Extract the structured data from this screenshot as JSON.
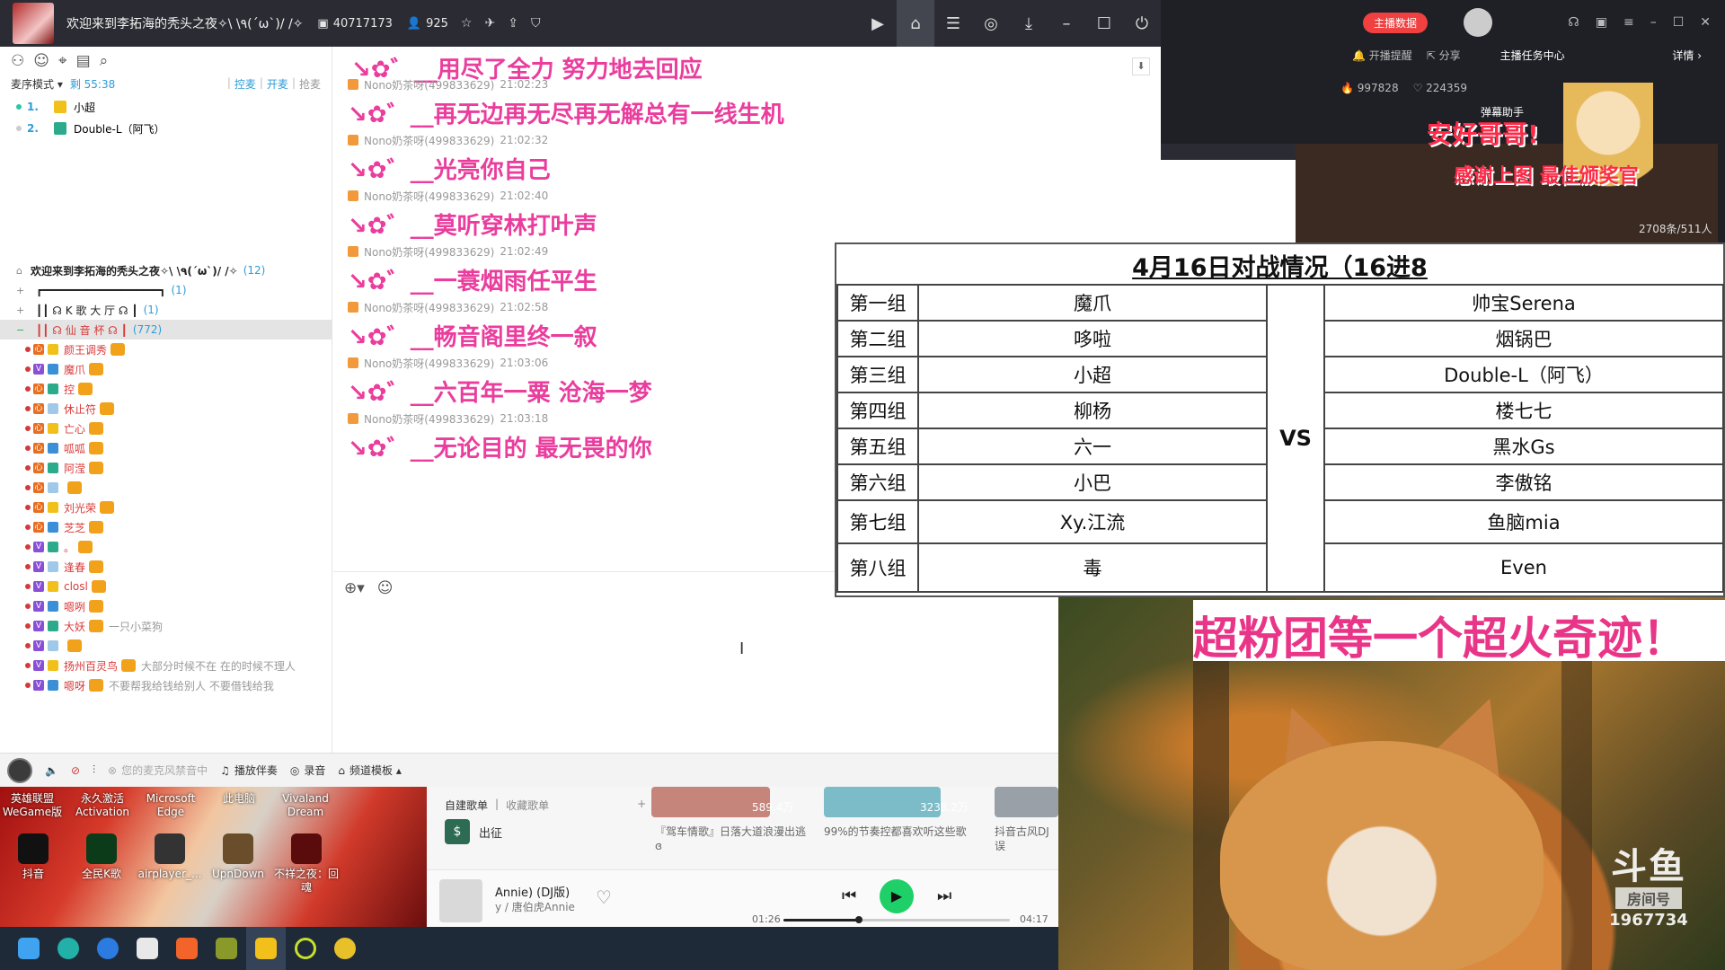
{
  "yy": {
    "title": "欢迎来到李拓海的秃头之夜✧\\ \\٩(ˊωˋ)/ /✧",
    "room_id": "40717173",
    "online": "925",
    "panel": {
      "mic_mode": "麦序模式 ▾",
      "remaining": "剩 55:38",
      "actions": [
        "控麦",
        "开麦",
        "抢麦"
      ],
      "queue": [
        {
          "num": "1.",
          "name": "小超"
        },
        {
          "num": "2.",
          "name": "Double-L（阿飞）"
        }
      ]
    },
    "tree": {
      "root": {
        "name": "欢迎来到李拓海的秃头之夜✧\\ \\٩(ˊωˋ)/ /✧",
        "count": "(12)"
      },
      "channels": [
        {
          "name": "┏━━━━━━━━━━━━━━━━━━┓",
          "count": "(1)"
        },
        {
          "name": "┃┃   ☊  K 歌 大 厅 ☊       ┃",
          "count": "(1)"
        },
        {
          "name": "┃┃   ☊   仙 音 杯   ☊      ┃",
          "count": "(772)"
        }
      ],
      "members": [
        {
          "lvl": "o",
          "name": "颜王调秀",
          "sig": ""
        },
        {
          "lvl": "v",
          "name": "魔爪",
          "sig": ""
        },
        {
          "lvl": "o",
          "name": "控",
          "sig": ""
        },
        {
          "lvl": "o",
          "name": "休止符",
          "sig": ""
        },
        {
          "lvl": "o",
          "name": "亡心",
          "sig": ""
        },
        {
          "lvl": "o",
          "name": "呱呱",
          "sig": ""
        },
        {
          "lvl": "o",
          "name": "阿滢",
          "sig": ""
        },
        {
          "lvl": "o",
          "name": "",
          "sig": ""
        },
        {
          "lvl": "o",
          "name": "刘光荣",
          "sig": ""
        },
        {
          "lvl": "o",
          "name": "芝芝",
          "sig": ""
        },
        {
          "lvl": "v",
          "name": "。",
          "sig": ""
        },
        {
          "lvl": "v",
          "name": "逢春",
          "sig": ""
        },
        {
          "lvl": "v",
          "name": "closl",
          "sig": ""
        },
        {
          "lvl": "v",
          "name": "嗯咧",
          "sig": ""
        },
        {
          "lvl": "v",
          "name": "大妖",
          "sig": "一只小菜狗"
        },
        {
          "lvl": "v",
          "name": "",
          "sig": ""
        },
        {
          "lvl": "v",
          "name": "扬州百灵鸟",
          "sig": "大部分时候不在  在的时候不理人"
        },
        {
          "lvl": "v",
          "name": "嗯呀",
          "sig": "不要帮我给钱给别人  不要借钱给我"
        }
      ]
    },
    "chat": {
      "first_text": "↘✿゛__用尽了全力 努力地去回应",
      "messages": [
        {
          "sender": "Nono奶茶呀(499833629)",
          "time": "21:02:23",
          "text": "↘✿゛__再无边再无尽再无解总有一线生机"
        },
        {
          "sender": "Nono奶茶呀(499833629)",
          "time": "21:02:32",
          "text": "↘✿゛__光亮你自己"
        },
        {
          "sender": "Nono奶茶呀(499833629)",
          "time": "21:02:40",
          "text": "↘✿゛__莫听穿林打叶声"
        },
        {
          "sender": "Nono奶茶呀(499833629)",
          "time": "21:02:49",
          "text": "↘✿゛__一蓑烟雨任平生"
        },
        {
          "sender": "Nono奶茶呀(499833629)",
          "time": "21:02:58",
          "text": "↘✿゛__畅音阁里终一叙"
        },
        {
          "sender": "Nono奶茶呀(499833629)",
          "time": "21:03:06",
          "text": "↘✿゛__六百年一粟 沧海一梦"
        },
        {
          "sender": "Nono奶茶呀(499833629)",
          "time": "21:03:18",
          "text": "↘✿゛__无论目的 最无畏的你"
        }
      ]
    },
    "bottombar": {
      "mic_hint": "您的麦克风禁音中",
      "accompany": "播放伴奏",
      "record": "录音",
      "template": "频道模板 ▴"
    }
  },
  "streamer": {
    "data_button": "主播数据",
    "reminder": "开播提醒",
    "share": "分享",
    "task_center": "主播任务中心",
    "detail": "详情 ›",
    "stat_a": "997828",
    "stat_b": "224359",
    "danmu_helper": "弹幕助手",
    "hello": "安好哥哥!",
    "thanks": "感谢上图 最佳颁奖官",
    "viewers": "2708条/511人"
  },
  "match": {
    "title": "4月16日对战情况（16进8",
    "vs": "VS",
    "rows": [
      {
        "group": "第一组",
        "a": "魔爪",
        "b": "帅宝Serena"
      },
      {
        "group": "第二组",
        "a": "哆啦",
        "b": "烟锅巴"
      },
      {
        "group": "第三组",
        "a": "小超",
        "b": "Double-L（阿飞）"
      },
      {
        "group": "第四组",
        "a": "柳杨",
        "b": "楼七七"
      },
      {
        "group": "第五组",
        "a": "六一",
        "b": "黑水Gs"
      },
      {
        "group": "第六组",
        "a": "小巴",
        "b": "李傲铭"
      },
      {
        "group": "第七组",
        "a": "Xy.江流",
        "b": "鱼脑mia"
      },
      {
        "group": "第八组",
        "a": "毒",
        "b": "Even"
      }
    ]
  },
  "overlay": {
    "banner": "超粉团等一个超火奇迹！",
    "douyu": "斗鱼",
    "room_label": "房间号",
    "room_number": "1967734"
  },
  "desktop": {
    "top_labels": [
      "英雄联盟\nWeGame版",
      "永久激活\nActivation",
      "Microsoft\nEdge",
      "此电脑",
      "Vivaland\nDream"
    ],
    "icons": [
      "抖音",
      "全民K歌",
      "airplayer_...",
      "UpnDown",
      "不祥之夜：回魂"
    ]
  },
  "music": {
    "tab_created": "自建歌单",
    "tab_collected": "收藏歌单",
    "playlist_name": "出征",
    "cards": [
      {
        "count": "589.4万",
        "title": "『驾车情歌』日落大道浪漫出逃ɞ"
      },
      {
        "count": "3238.2万",
        "title": "99%的节奏控都喜欢听这些歌"
      },
      {
        "count": "",
        "title": "抖音古风DJ误"
      }
    ],
    "song": "Annie) (DJ版)",
    "artist": "y / 唐伯虎Annie",
    "elapsed": "01:26",
    "total": "04:17",
    "progress": 0.3346
  },
  "colors": {
    "chat_pink": "#ea3d9d",
    "accent_blue": "#2d9dd8",
    "play_green": "#1fd069",
    "banner_pink": "#e93588"
  }
}
